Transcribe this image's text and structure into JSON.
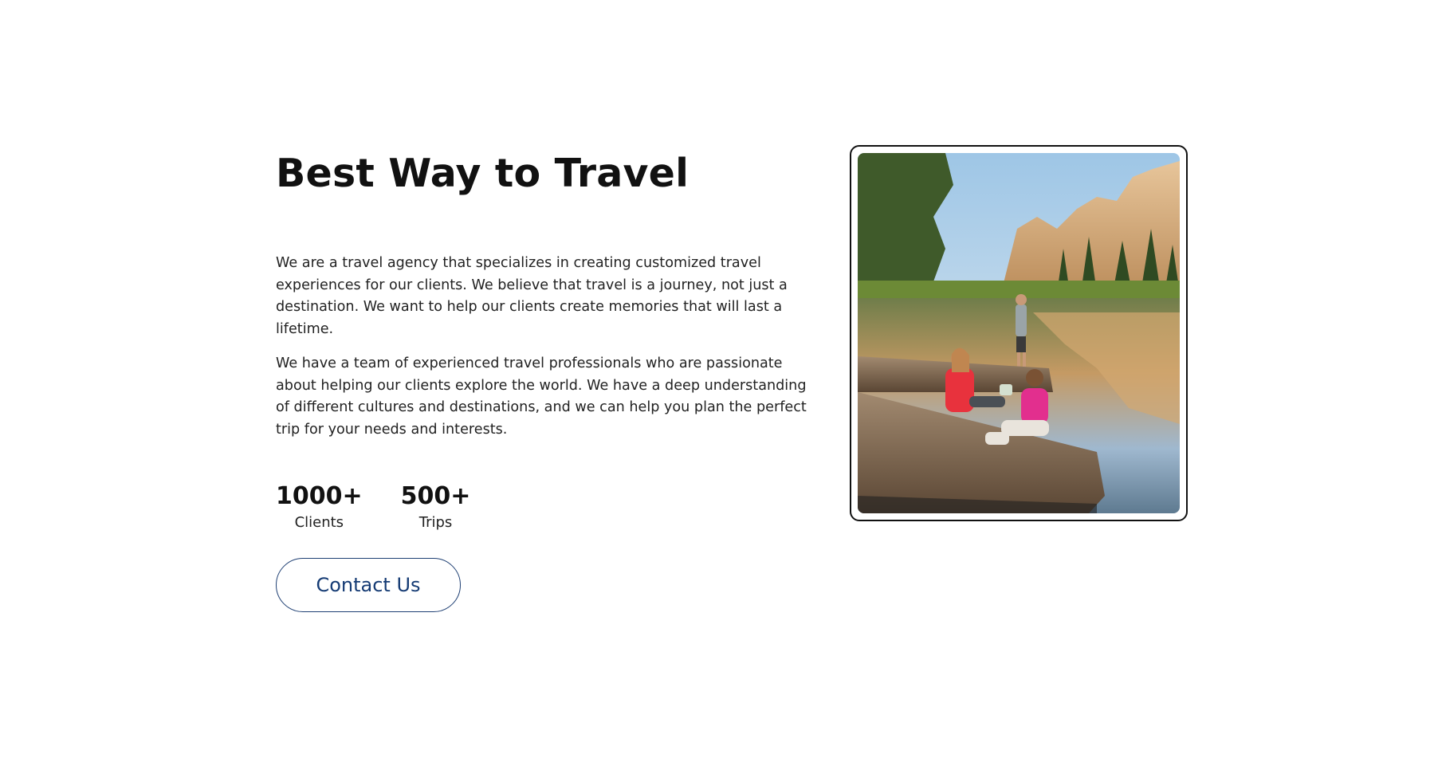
{
  "about": {
    "title": "Best Way to Travel",
    "paragraph_1": "We are a travel agency that specializes in creating customized travel experiences for our clients. We believe that travel is a journey, not just a destination. We want to help our clients create memories that will last a lifetime.",
    "paragraph_2": "We have a team of experienced travel professionals who are passionate about helping our clients explore the world. We have a deep understanding of different cultures and destinations, and we can help you plan the perfect trip for your needs and interests.",
    "stats": [
      {
        "value": "1000+",
        "label": "Clients"
      },
      {
        "value": "500+",
        "label": "Trips"
      }
    ],
    "contact_label": "Contact Us"
  },
  "colors": {
    "button_border": "#1e3f73",
    "button_text": "#153b74",
    "frame_border": "#111111"
  }
}
